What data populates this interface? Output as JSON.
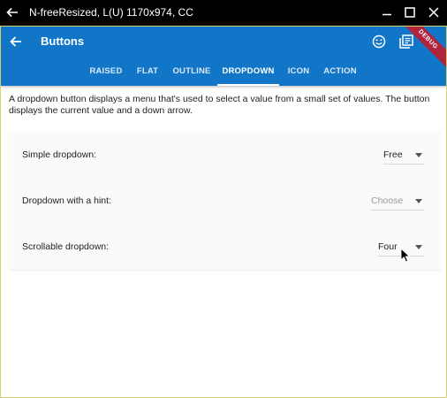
{
  "window": {
    "title": "N-freeResized, L(U) 1170x974, CC",
    "icons": [
      "back-arrow-icon",
      "minimize-icon",
      "maximize-icon",
      "close-icon"
    ]
  },
  "appbar": {
    "title": "Buttons",
    "debug_banner": "DEBUG",
    "actions": [
      "emoji-icon",
      "library-books-icon"
    ],
    "colors": {
      "primary": "#1176c8"
    }
  },
  "tabs": [
    {
      "label": "RAISED",
      "active": false
    },
    {
      "label": "FLAT",
      "active": false
    },
    {
      "label": "OUTLINE",
      "active": false
    },
    {
      "label": "DROPDOWN",
      "active": true
    },
    {
      "label": "ICON",
      "active": false
    },
    {
      "label": "ACTION",
      "active": false
    }
  ],
  "description": "A dropdown button displays a menu that's used to select a value from a small set of values. The button displays the current value and a down arrow.",
  "rows": [
    {
      "label": "Simple dropdown:",
      "value": "Free",
      "is_hint": false
    },
    {
      "label": "Dropdown with a hint:",
      "value": "Choose",
      "is_hint": true
    },
    {
      "label": "Scrollable dropdown:",
      "value": "Four",
      "is_hint": false
    }
  ]
}
